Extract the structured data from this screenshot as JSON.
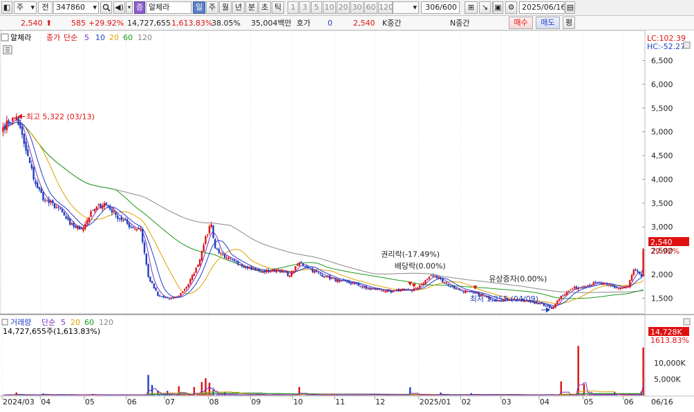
{
  "toolbar": {
    "market_type": "주",
    "period_mode": "전",
    "stock_code": "347860",
    "badge": "증",
    "stock_name": "알체라",
    "periods": [
      "일",
      "주",
      "월",
      "년",
      "분",
      "초",
      "틱"
    ],
    "active_period": "일",
    "intervals": [
      "1",
      "3",
      "5",
      "10",
      "20",
      "30",
      "60",
      "120"
    ],
    "count": "306/600",
    "date": "2025/06/16"
  },
  "quote": {
    "price": "2,540",
    "change": "585",
    "change_pct": "+29.92%",
    "volume": "14,727,655",
    "volume_ratio": "1,613.83%",
    "turnover": "38.05%",
    "amount": "35,004백만",
    "hoga_label": "호가",
    "hoga_value": "0",
    "hoga_price": "2,540",
    "k_label": "K중간",
    "n_label": "N중간",
    "buy_label": "매수",
    "sell_label": "매도",
    "avg_label": "평"
  },
  "colors": {
    "up": "#e01010",
    "down": "#1f3fbf",
    "ma5": "#7b2fbf",
    "ma10": "#1f3fbf",
    "ma20": "#e0a000",
    "ma60": "#1a9a1a",
    "ma120": "#888888"
  },
  "chart_data": [
    {
      "type": "candlestick",
      "legend": {
        "name": "알체라",
        "series_label": "종가",
        "ma_type": "단순",
        "ma_periods": [
          "5",
          "10",
          "20",
          "60",
          "120"
        ]
      },
      "ylim": [
        1200,
        6900
      ],
      "y_ticks": [
        "1,500",
        "2,000",
        "2,500",
        "3,000",
        "3,500",
        "4,000",
        "4,500",
        "5,000",
        "5,500",
        "6,000",
        "6,500"
      ],
      "lc_label": "LC:102.39",
      "hc_label": "HC:-52.27",
      "last_price_label": "2,540",
      "last_change_label": "29.92%",
      "annotations": [
        {
          "text": "최고 5,322 (03/13)",
          "date": "2024-03-13",
          "value": 5322
        },
        {
          "text": "최저 1,255 (04/09)",
          "date": "2025-04-09",
          "value": 1255
        },
        {
          "text": "권리락(-17.49%)",
          "date": "2024-12-26",
          "value": 1700
        },
        {
          "text": "배당락(0.00%)",
          "date": "2024-12-30",
          "value": 1660
        },
        {
          "text": "유상증자(0.00%)",
          "date": "2025-02-12",
          "value": 1620
        }
      ],
      "anchors": [
        [
          "2024-03-04",
          5100
        ],
        [
          "2024-03-13",
          5322
        ],
        [
          "2024-03-20",
          4600
        ],
        [
          "2024-03-27",
          3900
        ],
        [
          "2024-04-03",
          3550
        ],
        [
          "2024-04-12",
          3400
        ],
        [
          "2024-04-22",
          3050
        ],
        [
          "2024-04-30",
          2950
        ],
        [
          "2024-05-08",
          3350
        ],
        [
          "2024-05-16",
          3500
        ],
        [
          "2024-05-24",
          3250
        ],
        [
          "2024-06-05",
          3000
        ],
        [
          "2024-06-12",
          2950
        ],
        [
          "2024-06-18",
          1950
        ],
        [
          "2024-06-25",
          1550
        ],
        [
          "2024-07-03",
          1480
        ],
        [
          "2024-07-10",
          1550
        ],
        [
          "2024-07-17",
          1800
        ],
        [
          "2024-07-24",
          2200
        ],
        [
          "2024-07-30",
          2800
        ],
        [
          "2024-08-02",
          3050
        ],
        [
          "2024-08-06",
          2550
        ],
        [
          "2024-08-14",
          2350
        ],
        [
          "2024-08-22",
          2200
        ],
        [
          "2024-08-30",
          2150
        ],
        [
          "2024-09-09",
          2050
        ],
        [
          "2024-09-20",
          2100
        ],
        [
          "2024-09-30",
          1980
        ],
        [
          "2024-10-07",
          2250
        ],
        [
          "2024-10-15",
          2100
        ],
        [
          "2024-10-25",
          1950
        ],
        [
          "2024-11-05",
          1850
        ],
        [
          "2024-11-15",
          1800
        ],
        [
          "2024-11-25",
          1700
        ],
        [
          "2024-12-04",
          1680
        ],
        [
          "2024-12-12",
          1620
        ],
        [
          "2024-12-20",
          1700
        ],
        [
          "2024-12-27",
          1650
        ],
        [
          "2025-01-03",
          1800
        ],
        [
          "2025-01-10",
          1980
        ],
        [
          "2025-01-17",
          1900
        ],
        [
          "2025-01-24",
          1750
        ],
        [
          "2025-02-03",
          1650
        ],
        [
          "2025-02-12",
          1600
        ],
        [
          "2025-02-20",
          1520
        ],
        [
          "2025-02-28",
          1450
        ],
        [
          "2025-03-10",
          1480
        ],
        [
          "2025-03-20",
          1440
        ],
        [
          "2025-03-28",
          1400
        ],
        [
          "2025-04-04",
          1340
        ],
        [
          "2025-04-09",
          1280
        ],
        [
          "2025-04-16",
          1550
        ],
        [
          "2025-04-24",
          1700
        ],
        [
          "2025-05-02",
          1760
        ],
        [
          "2025-05-12",
          1820
        ],
        [
          "2025-05-20",
          1780
        ],
        [
          "2025-05-28",
          1700
        ],
        [
          "2025-06-04",
          1750
        ],
        [
          "2025-06-09",
          2100
        ],
        [
          "2025-06-13",
          1955
        ],
        [
          "2025-06-16",
          2540
        ]
      ]
    },
    {
      "type": "bar",
      "legend": {
        "name": "거래량",
        "ma_type": "단순",
        "ma_periods": [
          "5",
          "20",
          "60",
          "120"
        ]
      },
      "volume_text": "14,727,655주(1,613.83%)",
      "ylim": [
        0,
        15500000
      ],
      "y_ticks": [
        "5,000K",
        "10,000K"
      ],
      "last_label": "14,728K",
      "last_pct_label": "1613.83%",
      "base_volume": 200000,
      "spikes": [
        [
          "2024-03-13",
          900000
        ],
        [
          "2024-04-02",
          600000
        ],
        [
          "2024-05-08",
          450000
        ],
        [
          "2024-06-18",
          6300000
        ],
        [
          "2024-06-20",
          3200000
        ],
        [
          "2024-06-25",
          1500000
        ],
        [
          "2024-07-02",
          1400000
        ],
        [
          "2024-07-10",
          2800000
        ],
        [
          "2024-07-22",
          2600000
        ],
        [
          "2024-07-26",
          4100000
        ],
        [
          "2024-07-30",
          5300000
        ],
        [
          "2024-08-01",
          3900000
        ],
        [
          "2024-08-05",
          1800000
        ],
        [
          "2024-08-13",
          1000000
        ],
        [
          "2024-09-05",
          600000
        ],
        [
          "2024-10-07",
          2600000
        ],
        [
          "2024-12-26",
          2500000
        ],
        [
          "2025-01-17",
          900000
        ],
        [
          "2025-02-10",
          700000
        ],
        [
          "2025-04-16",
          4300000
        ],
        [
          "2025-04-29",
          15200000
        ],
        [
          "2025-05-02",
          3500000
        ],
        [
          "2025-05-26",
          1000000
        ],
        [
          "2025-06-13",
          1200000
        ],
        [
          "2025-06-16",
          14727655
        ]
      ],
      "x_axis_labels": [
        [
          "2024-03-04",
          "2024/03"
        ],
        [
          "2024-04-01",
          "04"
        ],
        [
          "2024-05-02",
          "05"
        ],
        [
          "2024-06-03",
          "06"
        ],
        [
          "2024-07-01",
          "07"
        ],
        [
          "2024-08-01",
          "08"
        ],
        [
          "2024-09-02",
          "09"
        ],
        [
          "2024-10-02",
          "10"
        ],
        [
          "2024-11-01",
          "11"
        ],
        [
          "2024-12-02",
          "12"
        ],
        [
          "2025-01-02",
          "2025/01"
        ],
        [
          "2025-02-03",
          "02"
        ],
        [
          "2025-03-04",
          "03"
        ],
        [
          "2025-04-01",
          "04"
        ],
        [
          "2025-05-02",
          "05"
        ],
        [
          "2025-06-02",
          "06"
        ]
      ],
      "x_end_label": "06/16"
    }
  ]
}
